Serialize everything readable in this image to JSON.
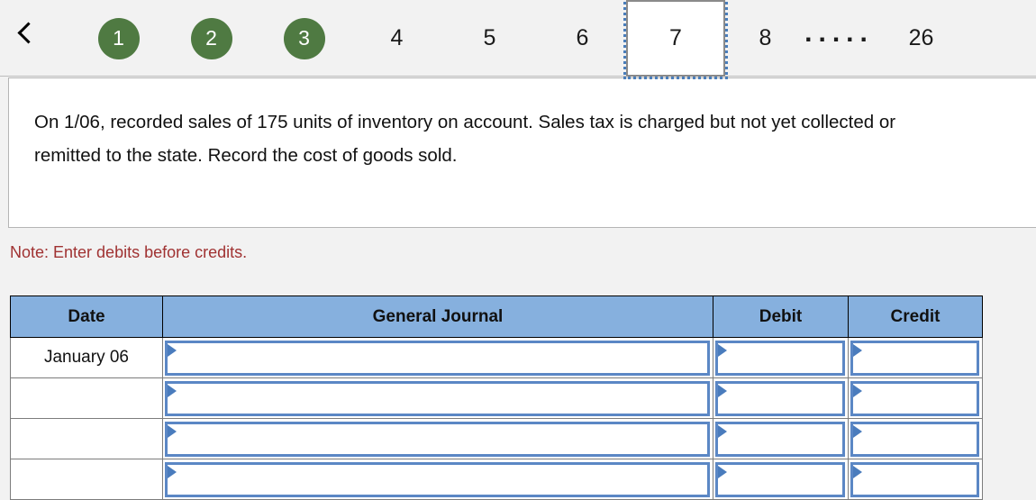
{
  "pager": {
    "back_label": "back-chevron",
    "items": [
      {
        "label": "1",
        "style": "circle"
      },
      {
        "label": "2",
        "style": "circle"
      },
      {
        "label": "3",
        "style": "circle"
      },
      {
        "label": "4",
        "style": "plain"
      },
      {
        "label": "5",
        "style": "plain"
      },
      {
        "label": "6",
        "style": "plain"
      },
      {
        "label": "7",
        "style": "selected"
      },
      {
        "label": "8",
        "style": "plain"
      },
      {
        "label": ".....",
        "style": "ellipsis"
      },
      {
        "label": "26",
        "style": "plain"
      }
    ],
    "selected": "7",
    "completed_color": "#4f7a42",
    "focus_outline_color": "#4a7ebb"
  },
  "question": {
    "text": "On 1/06, recorded sales of 175 units of inventory on account. Sales tax is charged but not yet collected or remitted to the state. Record the cost of goods sold."
  },
  "note": {
    "text": "Note: Enter debits before credits.",
    "color": "#a03232"
  },
  "journal": {
    "header_color": "#86b0de",
    "input_border_color": "#5b87c5",
    "columns": [
      "Date",
      "General Journal",
      "Debit",
      "Credit"
    ],
    "rows": [
      {
        "date": "January 06",
        "general_journal": "",
        "debit": "",
        "credit": ""
      },
      {
        "date": "",
        "general_journal": "",
        "debit": "",
        "credit": ""
      },
      {
        "date": "",
        "general_journal": "",
        "debit": "",
        "credit": ""
      },
      {
        "date": "",
        "general_journal": "",
        "debit": "",
        "credit": ""
      }
    ]
  }
}
